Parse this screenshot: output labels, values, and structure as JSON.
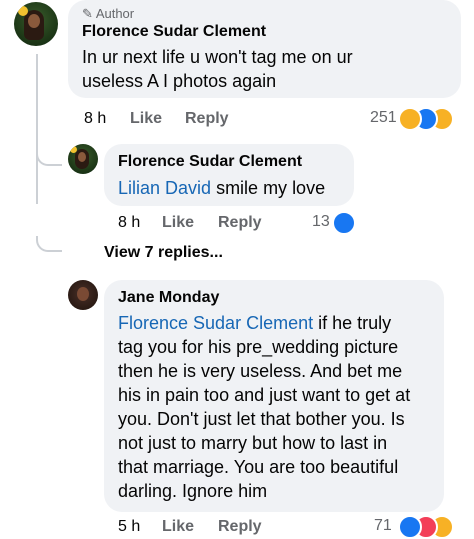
{
  "comments": [
    {
      "author_badge": "Author",
      "name": "Florence Sudar Clement",
      "text": "In ur next life u won't tag me on ur useless A I photos again",
      "time": "8 h",
      "like": "Like",
      "reply": "Reply",
      "reactions_count": "251",
      "reactions": [
        "haha-icon",
        "like-icon",
        "wow-icon"
      ]
    },
    {
      "name": "Florence Sudar Clement",
      "mention": "Lilian David",
      "text": " smile my love",
      "time": "8 h",
      "like": "Like",
      "reply": "Reply",
      "reactions_count": "13",
      "reactions": [
        "like-icon"
      ]
    },
    {
      "name": "Jane Monday",
      "mention": "Florence Sudar Clement",
      "text": " if he truly tag you for his pre_wedding picture then he is very useless. And bet me his in pain too and just want to get at you. Don't just let that bother you. Is not just to marry but how to last in that marriage. You are too beautiful darling. Ignore him",
      "time": "5 h",
      "like": "Like",
      "reply": "Reply",
      "reactions_count": "71",
      "reactions": [
        "like-icon",
        "love-icon",
        "haha-icon"
      ]
    }
  ],
  "view_replies": "View 7 replies...",
  "colors": {
    "like": "#1877f2",
    "love": "#f33e58",
    "haha": "#f7b125",
    "mention": "#1767b5"
  }
}
